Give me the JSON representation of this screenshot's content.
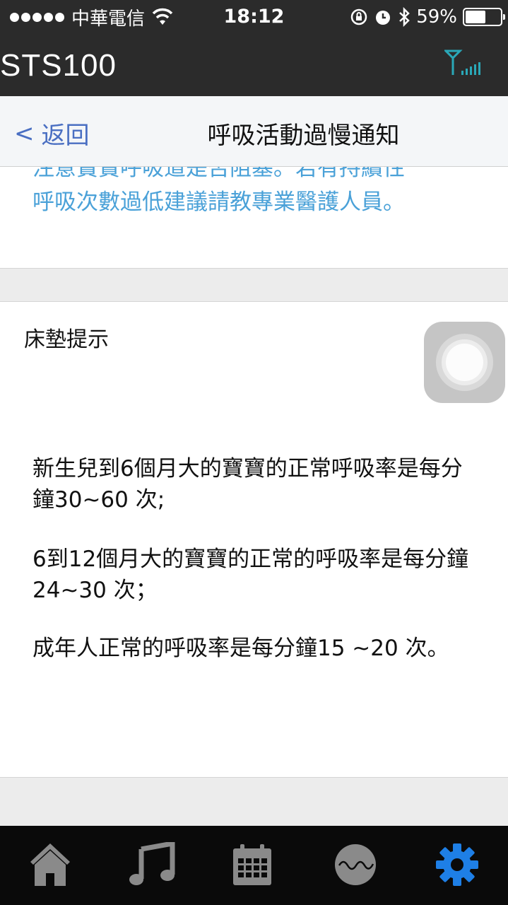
{
  "status_bar": {
    "carrier": "中華電信",
    "time": "18:12",
    "battery_percent": "59%",
    "battery_level": 0.59
  },
  "app": {
    "title": "STS100",
    "signal_icon": "antenna-signal-icon"
  },
  "nav": {
    "back_chevron": "<",
    "back_label": "返回",
    "title": "呼吸活動過慢通知"
  },
  "alert_card": {
    "text_partial": "注意寶寶呼吸道是否阻塞。若有持續性",
    "text": "呼吸次數過低建議請教專業醫護人員。",
    "color": "#4aa1d8"
  },
  "tips_card": {
    "label": "床墊提示",
    "paragraphs": [
      "新生兒到6個月大的寶寶的正常呼吸率是每分鐘30~60 次;",
      "6到12個月大的寶寶的正常的呼吸率是每分鐘24~30 次；",
      "成年人正常的呼吸率是每分鐘15 ~20 次。"
    ]
  },
  "tab_bar": {
    "items": [
      {
        "icon": "home-icon",
        "active": false
      },
      {
        "icon": "music-icon",
        "active": false
      },
      {
        "icon": "calendar-icon",
        "active": false
      },
      {
        "icon": "wave-icon",
        "active": false
      },
      {
        "icon": "gear-icon",
        "active": true
      }
    ],
    "inactive_color": "#8a8a8a",
    "active_color": "#1e7fe6"
  }
}
